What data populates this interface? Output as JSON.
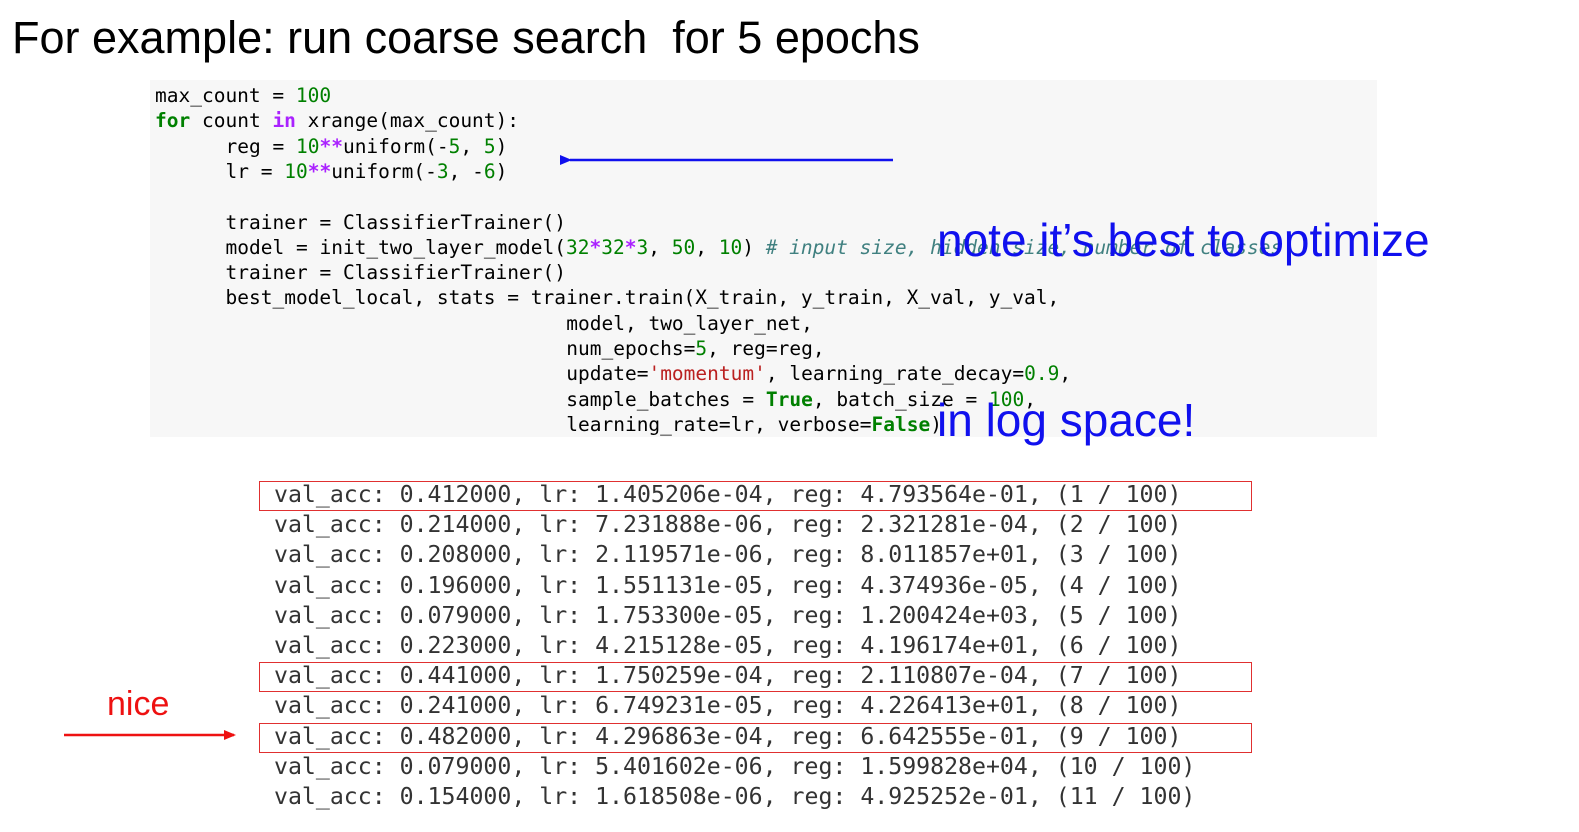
{
  "slide": {
    "title": "For example: run coarse search  for 5 epochs",
    "annotation_lines": [
      "note it’s best to optimize",
      "in log space!"
    ],
    "nice_label": "nice"
  },
  "code": {
    "lines": [
      "max_count = 100",
      "for count in xrange(max_count):",
      "      reg = 10**uniform(-5, 5)",
      "      lr = 10**uniform(-3, -6)",
      "",
      "      trainer = ClassifierTrainer()",
      "      model = init_two_layer_model(32*32*3, 50, 10) # input size, hidden size, number of classes",
      "      trainer = ClassifierTrainer()",
      "      best_model_local, stats = trainer.train(X_train, y_train, X_val, y_val,",
      "                                   model, two_layer_net,",
      "                                   num_epochs=5, reg=reg,",
      "                                   update='momentum', learning_rate_decay=0.9,",
      "                                   sample_batches = True, batch_size = 100,",
      "                                   learning_rate=lr, verbose=False)"
    ]
  },
  "output": {
    "rows": [
      {
        "text": "val_acc: 0.412000, lr: 1.405206e-04, reg: 4.793564e-01, (1 / 100)",
        "highlighted": true
      },
      {
        "text": "val_acc: 0.214000, lr: 7.231888e-06, reg: 2.321281e-04, (2 / 100)",
        "highlighted": false
      },
      {
        "text": "val_acc: 0.208000, lr: 2.119571e-06, reg: 8.011857e+01, (3 / 100)",
        "highlighted": false
      },
      {
        "text": "val_acc: 0.196000, lr: 1.551131e-05, reg: 4.374936e-05, (4 / 100)",
        "highlighted": false
      },
      {
        "text": "val_acc: 0.079000, lr: 1.753300e-05, reg: 1.200424e+03, (5 / 100)",
        "highlighted": false
      },
      {
        "text": "val_acc: 0.223000, lr: 4.215128e-05, reg: 4.196174e+01, (6 / 100)",
        "highlighted": false
      },
      {
        "text": "val_acc: 0.441000, lr: 1.750259e-04, reg: 2.110807e-04, (7 / 100)",
        "highlighted": true
      },
      {
        "text": "val_acc: 0.241000, lr: 6.749231e-05, reg: 4.226413e+01, (8 / 100)",
        "highlighted": false
      },
      {
        "text": "val_acc: 0.482000, lr: 4.296863e-04, reg: 6.642555e-01, (9 / 100)",
        "highlighted": true
      },
      {
        "text": "val_acc: 0.079000, lr: 5.401602e-06, reg: 1.599828e+04, (10 / 100)",
        "highlighted": false
      },
      {
        "text": "val_acc: 0.154000, lr: 1.618508e-06, reg: 4.925252e-01, (11 / 100)",
        "highlighted": false
      }
    ]
  },
  "colors": {
    "annotation": "#1010ee",
    "highlight": "#e03030",
    "nice": "#ee1111",
    "code_background": "#f7f7f7"
  }
}
